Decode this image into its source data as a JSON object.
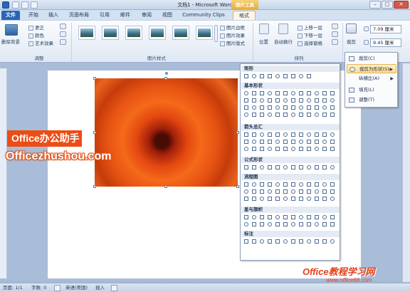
{
  "titlebar": {
    "app_title": "文档1 - Microsoft Word",
    "contextual_tab_group": "图片工具",
    "minimize": "–",
    "maximize": "□",
    "close": "✕"
  },
  "tabs": [
    "文件",
    "开始",
    "插入",
    "页面布局",
    "引用",
    "邮件",
    "审阅",
    "视图",
    "Community Clips",
    "格式"
  ],
  "ribbon": {
    "adjust": {
      "remove_background": "删除背景",
      "corrections": "更正",
      "color": "颜色",
      "artistic_effects": "艺术效果",
      "group_label": "调整"
    },
    "picture_styles": {
      "border": "图片边框",
      "effects": "图片效果",
      "layout": "图片版式",
      "group_label": "图片样式"
    },
    "arrange": {
      "position": "位置",
      "wrap_text": "自动换行",
      "bring_forward": "上移一层",
      "send_backward": "下移一层",
      "selection_pane": "选择窗格",
      "group_label": "排列"
    },
    "size": {
      "crop": "裁剪",
      "height": "7.09 厘米",
      "width": "9.45 厘米"
    }
  },
  "crop_menu": {
    "items": [
      {
        "label": "裁剪(C)",
        "has_submenu": false
      },
      {
        "label": "裁剪为形状(S)",
        "has_submenu": true
      },
      {
        "label": "纵横比(A)",
        "has_submenu": true
      },
      {
        "label": "填充(L)",
        "has_submenu": false
      },
      {
        "label": "调整(T)",
        "has_submenu": false
      }
    ]
  },
  "shapes_gallery": {
    "sections": [
      "矩形",
      "基本形状",
      "箭头总汇",
      "公式形状",
      "流程图",
      "星与旗帜",
      "标注"
    ]
  },
  "watermarks": {
    "box_text": "Office办公助手",
    "site_text": "Officezhushou.com",
    "br_title": "Office教程学习网",
    "br_url": "www.office68.com"
  },
  "statusbar": {
    "page": "页面: 1/1",
    "words": "字数: 0",
    "language": "英语(美国)",
    "mode": "插入"
  }
}
